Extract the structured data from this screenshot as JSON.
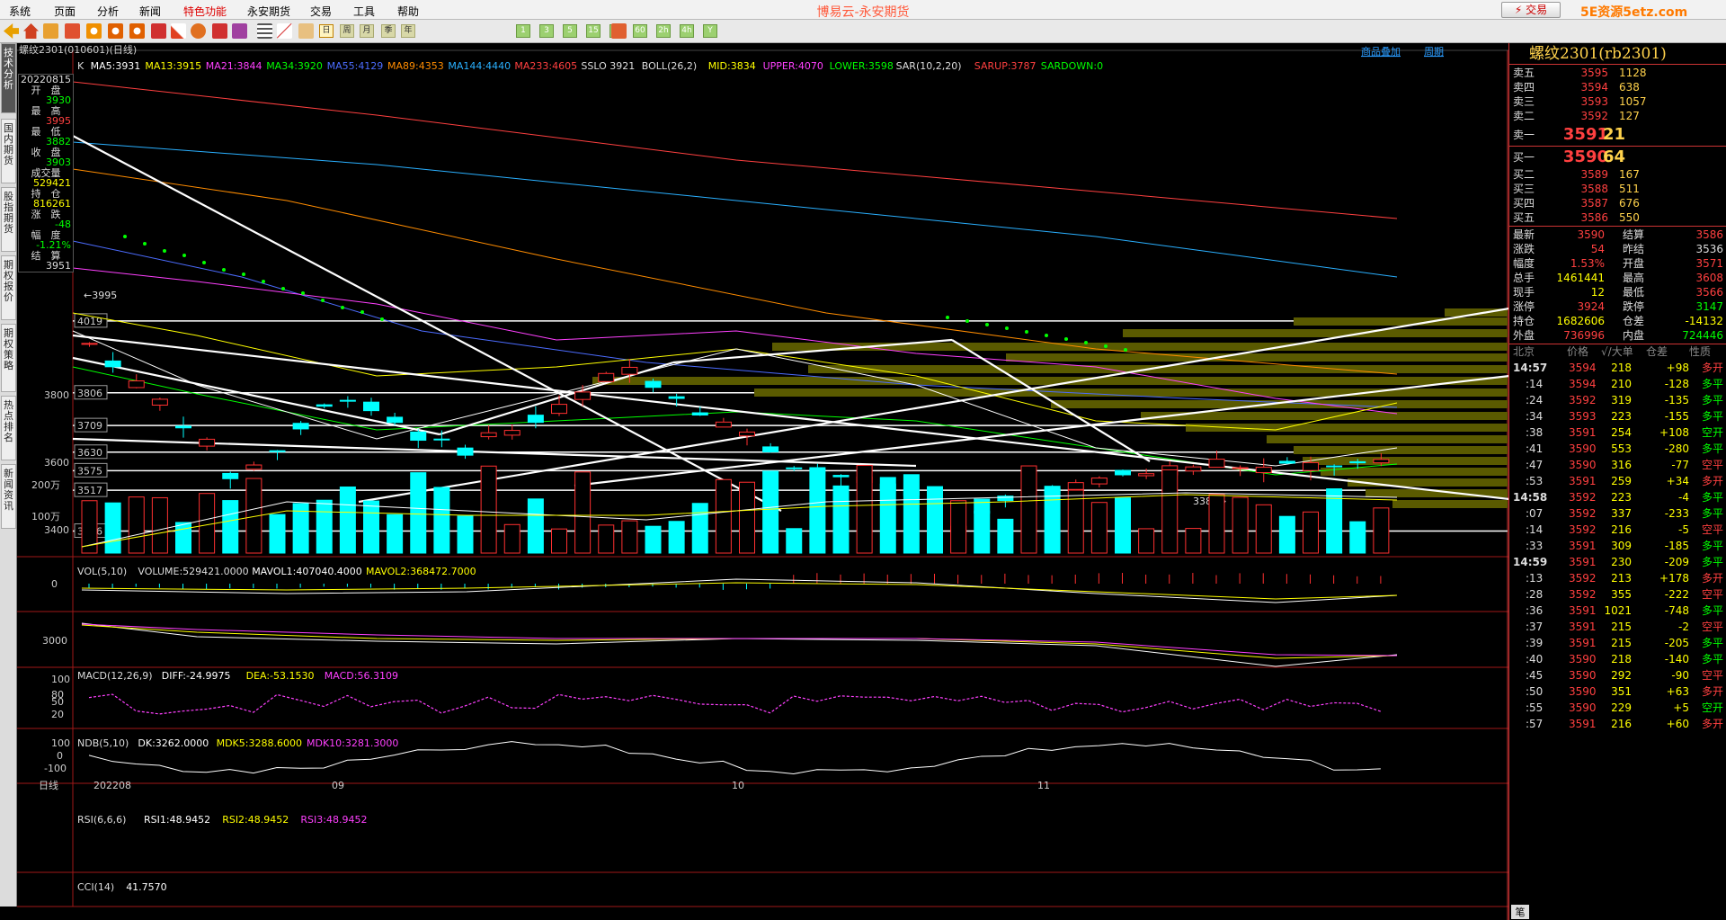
{
  "app": {
    "title": "博易云-永安期货",
    "trade_label": "⚡ 交易",
    "watermark": "5E资源5etz.com"
  },
  "menu": [
    "系统",
    "页面",
    "分析",
    "新闻",
    "特色功能",
    "永安期货",
    "交易",
    "工具",
    "帮助"
  ],
  "toolbar": {
    "period_buttons": [
      "1",
      "3",
      "5",
      "15",
      "30",
      "60",
      "2h",
      "4h",
      "Y"
    ]
  },
  "left_tabs": [
    "技术分析",
    "国内期货",
    "股指期货",
    "期权报价",
    "期权策略",
    "热点排名",
    "新闻资讯"
  ],
  "chart": {
    "header": {
      "symbol": "螺纹2301(010601)(日线)",
      "links": [
        "商品叠加",
        "周期"
      ]
    },
    "ma_line": [
      {
        "t": "K",
        "c": "#dddddd"
      },
      {
        "t": "MA5:3931",
        "c": "#ffffff"
      },
      {
        "t": "MA13:3915",
        "c": "#ffff00"
      },
      {
        "t": "MA21:3844",
        "c": "#ff40ff"
      },
      {
        "t": "MA34:3920",
        "c": "#00ff00"
      },
      {
        "t": "MA55:4129",
        "c": "#4c6cff"
      },
      {
        "t": "MA89:4353",
        "c": "#ff8c00"
      },
      {
        "t": "MA144:4440",
        "c": "#2ab0ff"
      },
      {
        "t": "MA233:4605",
        "c": "#ff4040"
      },
      {
        "t": "SSLO 3921",
        "c": "#dddddd"
      },
      {
        "t": "BOLL(26,2)",
        "c": "#dddddd"
      },
      {
        "t": "MID:3834",
        "c": "#ffff00"
      },
      {
        "t": "UPPER:4070",
        "c": "#ff40ff"
      },
      {
        "t": "LOWER:3598",
        "c": "#00ff00"
      },
      {
        "t": "SAR(10,2,20)",
        "c": "#dddddd"
      },
      {
        "t": "SARUP:3787",
        "c": "#ff4040"
      },
      {
        "t": "SARDOWN:0",
        "c": "#00ff00"
      }
    ],
    "ohlc": {
      "date": "20220815",
      "rows": [
        {
          "label": "开　盘",
          "value": "3930",
          "color": "#00ff00"
        },
        {
          "label": "最　高",
          "value": "3995",
          "color": "#ff4040"
        },
        {
          "label": "最　低",
          "value": "3882",
          "color": "#00ff00"
        },
        {
          "label": "收　盘",
          "value": "3903",
          "color": "#00ff00"
        },
        {
          "label": "成交量",
          "value": "529421",
          "color": "#ffff00"
        },
        {
          "label": "持　仓",
          "value": "816261",
          "color": "#ffff00"
        },
        {
          "label": "涨　跌",
          "value": "-48",
          "color": "#00ff00"
        },
        {
          "label": "幅　度",
          "value": "-1.21%",
          "color": "#00ff00"
        },
        {
          "label": "结　算",
          "value": "3951",
          "color": "#dddddd"
        }
      ]
    },
    "axis_labels": [
      "3800",
      "3600",
      "3400"
    ],
    "price_levels": [
      "4019",
      "3806",
      "3709",
      "3630",
      "3575",
      "3517",
      "3396"
    ],
    "annotations": [
      "←3995",
      "3389→"
    ],
    "volume": {
      "header": [
        {
          "t": "VOL(5,10)",
          "c": "#dddddd"
        },
        {
          "t": "VOLUME:529421.0000",
          "c": "#dddddd"
        },
        {
          "t": "MAVOL1:407040.4000",
          "c": "#ffffff"
        },
        {
          "t": "MAVOL2:368472.7000",
          "c": "#ffff00"
        }
      ],
      "axis": [
        "200万",
        "100万"
      ]
    },
    "macd": {
      "header": [
        {
          "t": "MACD(12,26,9)",
          "c": "#dddddd"
        },
        {
          "t": "DIFF:-24.9975",
          "c": "#ffffff"
        },
        {
          "t": "DEA:-53.1530",
          "c": "#ffff00"
        },
        {
          "t": "MACD:56.3109",
          "c": "#ff40ff"
        }
      ],
      "axis": [
        "0"
      ]
    },
    "ndb": {
      "header": [
        {
          "t": "NDB(5,10)",
          "c": "#dddddd"
        },
        {
          "t": "DK:3262.0000",
          "c": "#ffffff"
        },
        {
          "t": "MDK5:3288.6000",
          "c": "#ffff00"
        },
        {
          "t": "MDK10:3281.3000",
          "c": "#ff40ff"
        }
      ],
      "axis": [
        "3000"
      ]
    },
    "rsi": {
      "header": [
        {
          "t": "RSI(6,6,6)",
          "c": "#dddddd"
        },
        {
          "t": "RSI1:48.9452",
          "c": "#ffffff"
        },
        {
          "t": "RSI2:48.9452",
          "c": "#ffff00"
        },
        {
          "t": "RSI3:48.9452",
          "c": "#ff40ff"
        }
      ],
      "axis": [
        "100",
        "80",
        "50",
        "20"
      ]
    },
    "cci": {
      "header": [
        {
          "t": "CCI(14)",
          "c": "#dddddd"
        },
        {
          "t": "41.7570",
          "c": "#ffffff"
        }
      ],
      "axis": [
        "100",
        "0",
        "-100"
      ]
    },
    "xaxis": {
      "period": "日线",
      "labels": [
        "202208",
        "09",
        "10",
        "11"
      ]
    }
  },
  "quote": {
    "title": "螺纹2301(rb2301)",
    "asks": [
      {
        "label": "卖五",
        "price": "3595",
        "vol": "1128"
      },
      {
        "label": "卖四",
        "price": "3594",
        "vol": "638"
      },
      {
        "label": "卖三",
        "price": "3593",
        "vol": "1057"
      },
      {
        "label": "卖二",
        "price": "3592",
        "vol": "127"
      },
      {
        "label": "卖一",
        "price": "3591",
        "vol": "21"
      }
    ],
    "bids": [
      {
        "label": "买一",
        "price": "3590",
        "vol": "64"
      },
      {
        "label": "买二",
        "price": "3589",
        "vol": "167"
      },
      {
        "label": "买三",
        "price": "3588",
        "vol": "511"
      },
      {
        "label": "买四",
        "price": "3587",
        "vol": "676"
      },
      {
        "label": "买五",
        "price": "3586",
        "vol": "550"
      }
    ],
    "stats": [
      {
        "l": "最新",
        "v": "3590",
        "c": "#ff4040",
        "l2": "结算",
        "v2": "3586",
        "c2": "#ff4040"
      },
      {
        "l": "涨跌",
        "v": "54",
        "c": "#ff4040",
        "l2": "昨结",
        "v2": "3536",
        "c2": "#dddddd"
      },
      {
        "l": "幅度",
        "v": "1.53%",
        "c": "#ff4040",
        "l2": "开盘",
        "v2": "3571",
        "c2": "#ff4040"
      },
      {
        "l": "总手",
        "v": "1461441",
        "c": "#ffff00",
        "l2": "最高",
        "v2": "3608",
        "c2": "#ff4040"
      },
      {
        "l": "现手",
        "v": "12",
        "c": "#ffff00",
        "l2": "最低",
        "v2": "3566",
        "c2": "#ff4040"
      },
      {
        "l": "涨停",
        "v": "3924",
        "c": "#ff4040",
        "l2": "跌停",
        "v2": "3147",
        "c2": "#00ff00"
      },
      {
        "l": "持仓",
        "v": "1682606",
        "c": "#ffff00",
        "l2": "仓差",
        "v2": "-14132",
        "c2": "#ffff00"
      },
      {
        "l": "外盘",
        "v": "736996",
        "c": "#ff4040",
        "l2": "内盘",
        "v2": "724446",
        "c2": "#00ff00"
      }
    ],
    "tick_header": [
      "北京",
      "价格",
      "√/大单",
      "仓差",
      "性质"
    ],
    "ticks": [
      {
        "time": "14:57",
        "price": "3594",
        "vol": "218",
        "diff": "+98",
        "nature": "多开",
        "color": "#ff4040",
        "major": true
      },
      {
        "time": ":14",
        "price": "3594",
        "vol": "210",
        "diff": "-128",
        "nature": "多平",
        "color": "#00ff00"
      },
      {
        "time": ":24",
        "price": "3592",
        "vol": "319",
        "diff": "-135",
        "nature": "多平",
        "color": "#00ff00"
      },
      {
        "time": ":34",
        "price": "3593",
        "vol": "223",
        "diff": "-155",
        "nature": "多平",
        "color": "#00ff00"
      },
      {
        "time": ":38",
        "price": "3591",
        "vol": "254",
        "diff": "+108",
        "nature": "空开",
        "color": "#00ff00"
      },
      {
        "time": ":41",
        "price": "3590",
        "vol": "553",
        "diff": "-280",
        "nature": "多平",
        "color": "#00ff00"
      },
      {
        "time": ":47",
        "price": "3590",
        "vol": "316",
        "diff": "-77",
        "nature": "空平",
        "color": "#ff4040"
      },
      {
        "time": ":53",
        "price": "3591",
        "vol": "259",
        "diff": "+34",
        "nature": "多开",
        "color": "#ff4040"
      },
      {
        "time": "14:58",
        "price": "3592",
        "vol": "223",
        "diff": "-4",
        "nature": "多平",
        "color": "#00ff00",
        "major": true
      },
      {
        "time": ":07",
        "price": "3592",
        "vol": "337",
        "diff": "-233",
        "nature": "多平",
        "color": "#00ff00"
      },
      {
        "time": ":14",
        "price": "3592",
        "vol": "216",
        "diff": "-5",
        "nature": "空平",
        "color": "#ff4040"
      },
      {
        "time": ":33",
        "price": "3591",
        "vol": "309",
        "diff": "-185",
        "nature": "多平",
        "color": "#00ff00"
      },
      {
        "time": "14:59",
        "price": "3591",
        "vol": "230",
        "diff": "-209",
        "nature": "多平",
        "color": "#00ff00",
        "major": true
      },
      {
        "time": ":13",
        "price": "3592",
        "vol": "213",
        "diff": "+178",
        "nature": "多开",
        "color": "#ff4040"
      },
      {
        "time": ":28",
        "price": "3592",
        "vol": "355",
        "diff": "-222",
        "nature": "空平",
        "color": "#ff4040"
      },
      {
        "time": ":36",
        "price": "3591",
        "vol": "1021",
        "diff": "-748",
        "nature": "多平",
        "color": "#00ff00"
      },
      {
        "time": ":37",
        "price": "3591",
        "vol": "215",
        "diff": "-2",
        "nature": "空平",
        "color": "#ff4040"
      },
      {
        "time": ":39",
        "price": "3591",
        "vol": "215",
        "diff": "-205",
        "nature": "多平",
        "color": "#00ff00"
      },
      {
        "time": ":40",
        "price": "3590",
        "vol": "218",
        "diff": "-140",
        "nature": "多平",
        "color": "#00ff00"
      },
      {
        "time": ":45",
        "price": "3590",
        "vol": "292",
        "diff": "-90",
        "nature": "空平",
        "color": "#ff4040"
      },
      {
        "time": ":50",
        "price": "3590",
        "vol": "351",
        "diff": "+63",
        "nature": "多开",
        "color": "#ff4040"
      },
      {
        "time": ":55",
        "price": "3590",
        "vol": "229",
        "diff": "+5",
        "nature": "空开",
        "color": "#00ff00"
      },
      {
        "time": ":57",
        "price": "3591",
        "vol": "216",
        "diff": "+60",
        "nature": "多开",
        "color": "#ff4040"
      }
    ],
    "footer": "笔"
  }
}
